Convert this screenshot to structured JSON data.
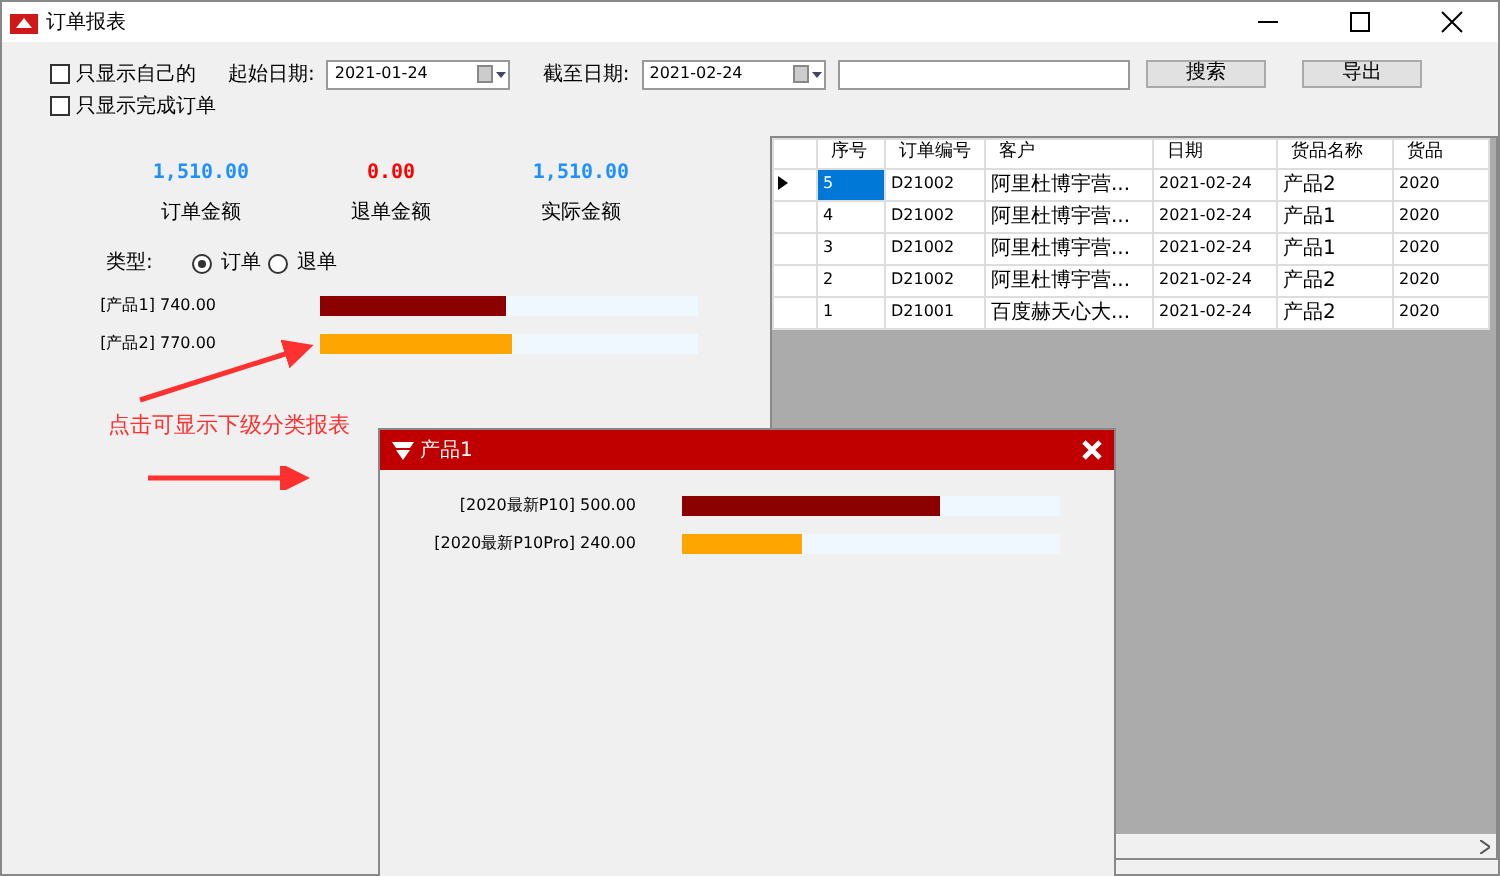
{
  "window": {
    "title": "订单报表"
  },
  "filters": {
    "checkboxes": [
      {
        "label": "只显示自己的",
        "checked": false
      },
      {
        "label": "只显示完成订单",
        "checked": false
      }
    ],
    "start_date": {
      "label": "起始日期:",
      "value": "2021-01-24"
    },
    "end_date": {
      "label": "截至日期:",
      "value": "2021-02-24"
    },
    "buttons": [
      "搜索",
      "导出"
    ]
  },
  "summary": [
    {
      "value": "1,510.00",
      "label": "订单金额",
      "color": "#1e90ff"
    },
    {
      "value": "0.00",
      "label": "退单金额",
      "color": "#ff0000"
    },
    {
      "value": "1,510.00",
      "label": "实际金额",
      "color": "#1e90ff"
    }
  ],
  "type_filter": {
    "label": "类型:",
    "options": [
      {
        "label": "订单",
        "selected": true
      },
      {
        "label": "退单",
        "selected": false
      }
    ]
  },
  "bars": [
    {
      "label": "[产品1] 740.00",
      "level": 0.49,
      "color": "#8b0000"
    },
    {
      "label": "[产品2] 770.00",
      "level": 0.51,
      "color": "#ffa500"
    }
  ],
  "annotation": "点击可显示下级分类报表",
  "table": {
    "columns": [
      "序号",
      "订单编号",
      "客户",
      "日期",
      "货品名称",
      "货品"
    ],
    "rows": [
      {
        "selected": true,
        "cells": [
          "5",
          "D21002",
          "阿里杜博宇营...",
          "2021-02-24",
          "产品2",
          "2020"
        ]
      },
      {
        "selected": false,
        "cells": [
          "4",
          "D21002",
          "阿里杜博宇营...",
          "2021-02-24",
          "产品1",
          "2020"
        ]
      },
      {
        "selected": false,
        "cells": [
          "3",
          "D21002",
          "阿里杜博宇营...",
          "2021-02-24",
          "产品1",
          "2020"
        ]
      },
      {
        "selected": false,
        "cells": [
          "2",
          "D21002",
          "阿里杜博宇营...",
          "2021-02-24",
          "产品2",
          "2020"
        ]
      },
      {
        "selected": false,
        "cells": [
          "1",
          "D21001",
          "百度赫天心大...",
          "2021-02-24",
          "产品2",
          "2020"
        ]
      }
    ]
  },
  "popup": {
    "title": "产品1",
    "bars": [
      {
        "label": "[2020最新P10] 500.00",
        "level": 0.68,
        "color": "#8b0000"
      },
      {
        "label": "[2020最新P10Pro] 240.00",
        "level": 0.32,
        "color": "#ffa500"
      }
    ]
  }
}
